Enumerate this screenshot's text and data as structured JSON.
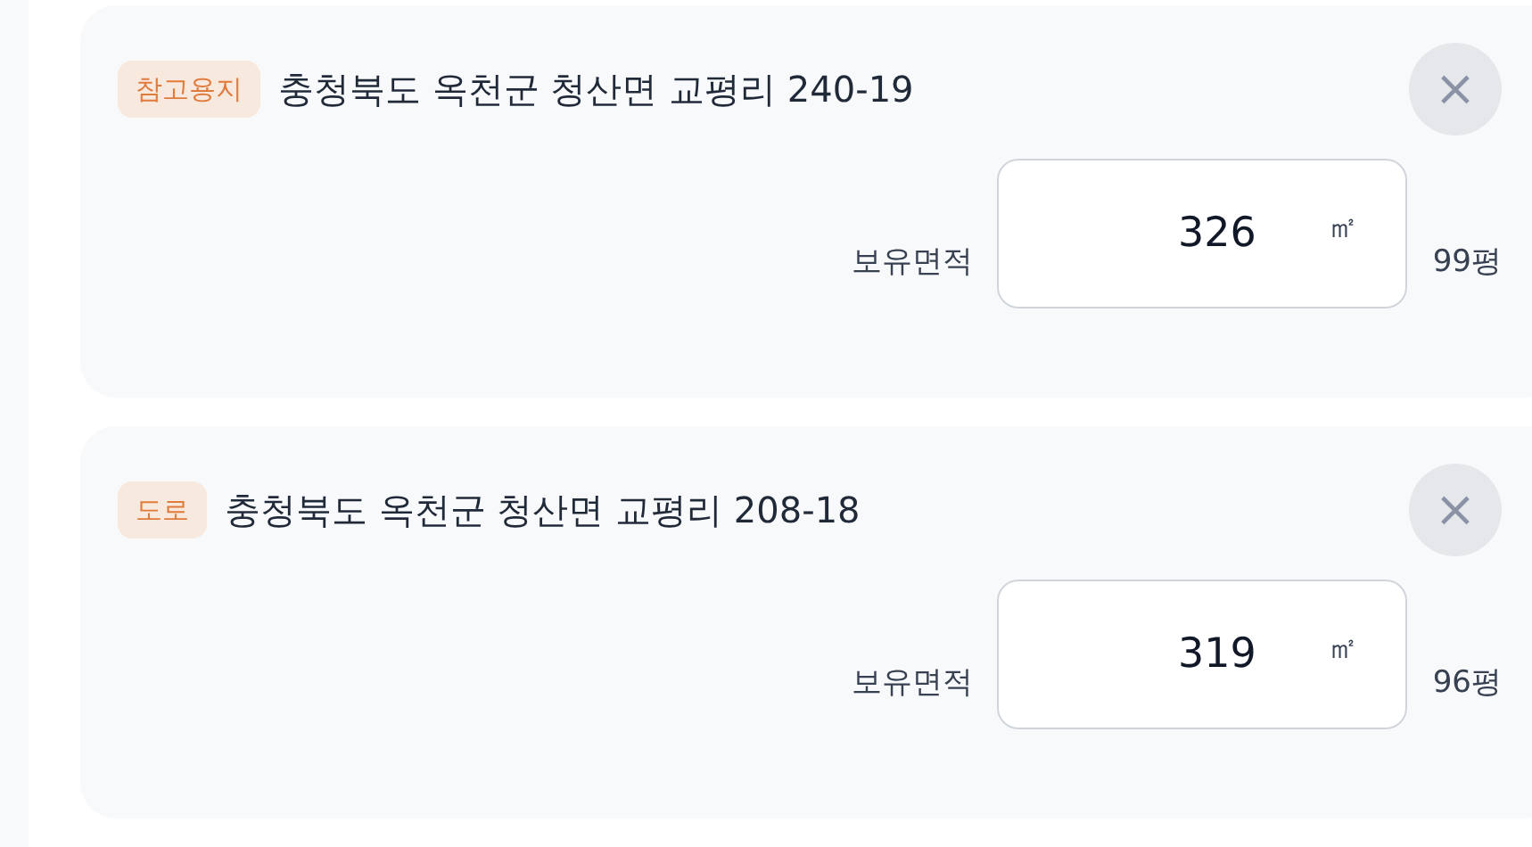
{
  "parcels": [
    {
      "badge": "참고용지",
      "address": "충청북도 옥천군 청산면 교평리 240-19",
      "close": "×",
      "area_label": "보유면적",
      "value": "326",
      "unit": "㎡",
      "pyeong": "99평"
    },
    {
      "badge": "도로",
      "address": "충청북도 옥천군 청산면 교평리 208-18",
      "close": "×",
      "area_label": "보유면적",
      "value": "319",
      "unit": "㎡",
      "pyeong": "96평"
    }
  ]
}
